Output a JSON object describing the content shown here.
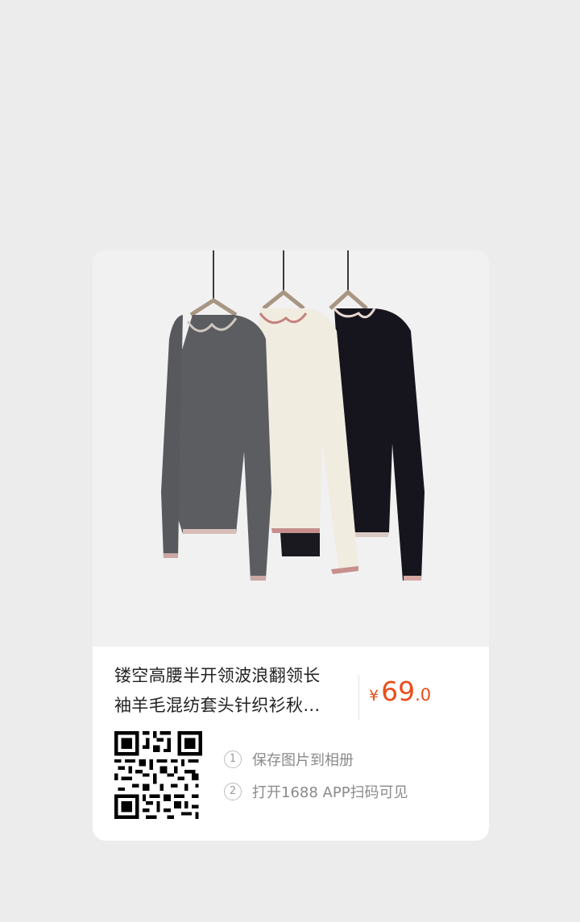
{
  "product": {
    "title_line1": "镂空高腰半开领波浪翻领长",
    "title_line2": "袖羊毛混纺套头针织衫秋…",
    "price": {
      "currency": "¥",
      "integer": "69",
      "decimal": ".0"
    },
    "image": "three-knit-polo-sweaters-hanging-grey-cream-black"
  },
  "instructions": [
    {
      "num": "1",
      "text": "保存图片到相册"
    },
    {
      "num": "2",
      "text": "打开1688 APP扫码可见"
    }
  ],
  "qr_code": "qr-code-icon",
  "colors": {
    "page_background": "#ececec",
    "card_background": "#ffffff",
    "price": "#ea4d1b",
    "title": "#222222",
    "instruction_text": "#8a8a8a"
  }
}
